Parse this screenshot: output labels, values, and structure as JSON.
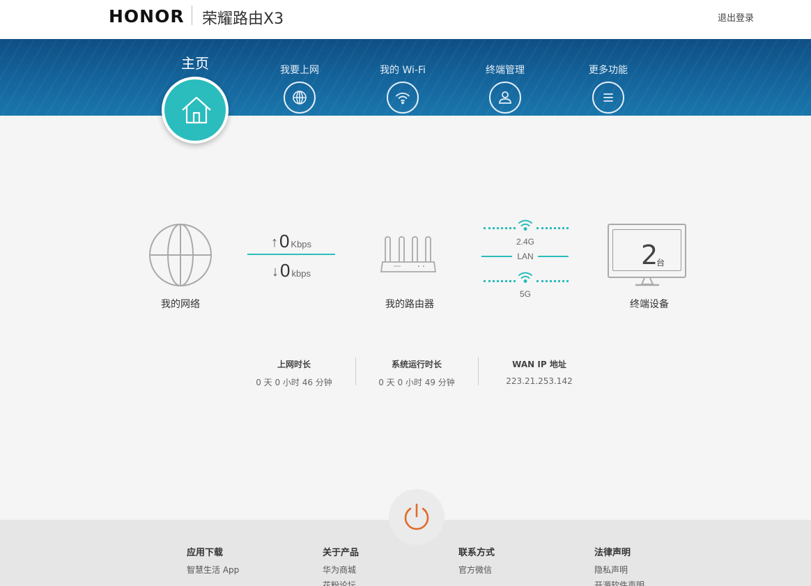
{
  "header": {
    "brand": "HONOR",
    "product": "荣耀路由X3",
    "logout": "退出登录"
  },
  "nav": {
    "home": "主页",
    "items": [
      {
        "label": "我要上网",
        "icon": "globe-icon"
      },
      {
        "label": "我的 Wi-Fi",
        "icon": "wifi-icon"
      },
      {
        "label": "终端管理",
        "icon": "user-icon"
      },
      {
        "label": "更多功能",
        "icon": "menu-icon"
      }
    ]
  },
  "topology": {
    "network_label": "我的网络",
    "upload_value": "0",
    "upload_unit": "Kbps",
    "download_value": "0",
    "download_unit": "kbps",
    "router_label": "我的路由器",
    "band_24": "2.4G",
    "lan": "LAN",
    "band_5": "5G",
    "device_count": "2",
    "device_unit": "台",
    "devices_label": "终端设备"
  },
  "stats": [
    {
      "title": "上网时长",
      "value": "0 天 0 小时 46 分钟"
    },
    {
      "title": "系统运行时长",
      "value": "0 天 0 小时 49 分钟"
    },
    {
      "title": "WAN IP 地址",
      "value": "223.21.253.142"
    }
  ],
  "footer": {
    "columns": [
      {
        "title": "应用下载",
        "links": [
          "智慧生活 App"
        ]
      },
      {
        "title": "关于产品",
        "links": [
          "华为商城",
          "花粉论坛"
        ]
      },
      {
        "title": "联系方式",
        "links": [
          "官方微信"
        ]
      },
      {
        "title": "法律声明",
        "links": [
          "隐私声明",
          "开源软件声明"
        ]
      }
    ]
  },
  "colors": {
    "accent": "#2bbcbd",
    "nav_bg": "#14659c",
    "power": "#e06b2b"
  }
}
